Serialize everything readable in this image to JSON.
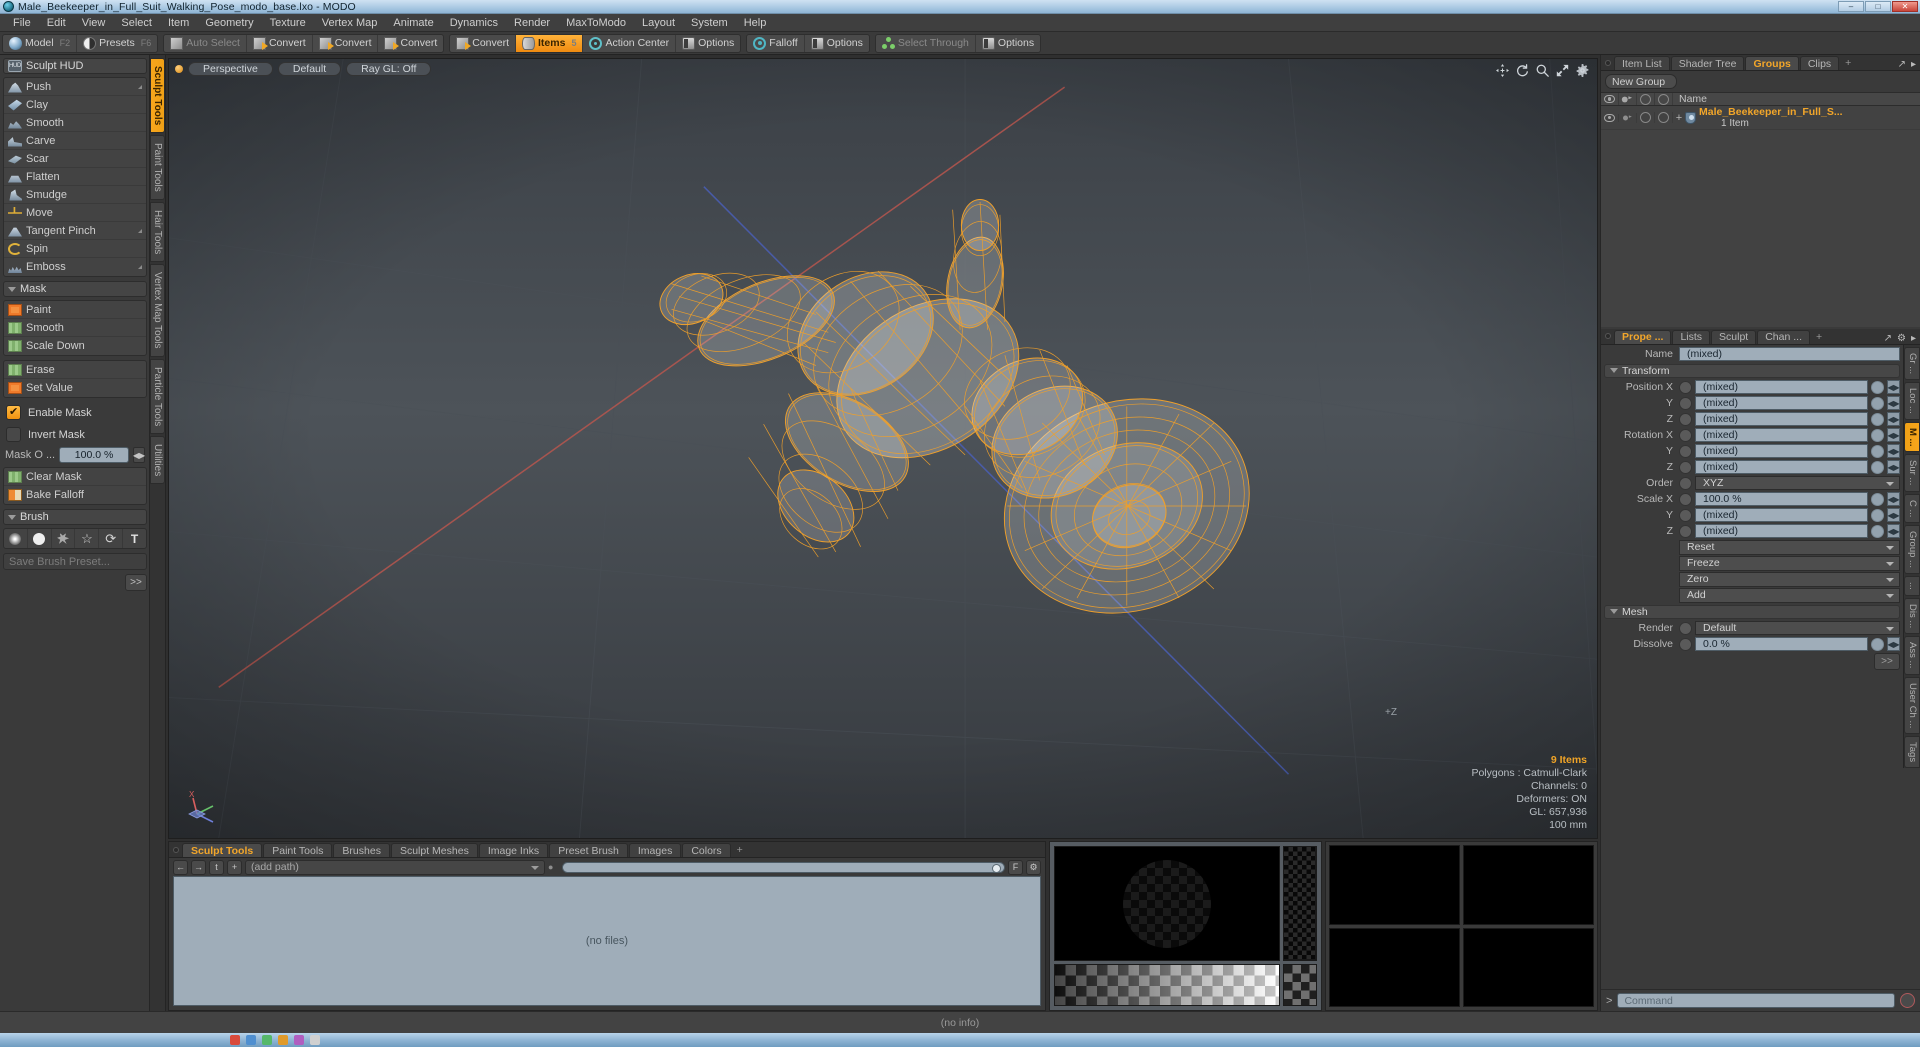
{
  "window": {
    "title": "Male_Beekeeper_in_Full_Suit_Walking_Pose_modo_base.lxo - MODO",
    "min_label": "–",
    "max_label": "□",
    "close_label": "✕"
  },
  "menubar": {
    "items": [
      "File",
      "Edit",
      "View",
      "Select",
      "Item",
      "Geometry",
      "Texture",
      "Vertex Map",
      "Animate",
      "Dynamics",
      "Render",
      "MaxToModo",
      "Layout",
      "System",
      "Help"
    ]
  },
  "toolbar": {
    "groups": [
      {
        "buttons": [
          {
            "label": "Model",
            "icon": "sphere-icon",
            "fkey": "F2",
            "state": "normal"
          },
          {
            "label": "Presets",
            "icon": "half-sphere-icon",
            "fkey": "F6",
            "state": "normal"
          }
        ]
      },
      {
        "buttons": [
          {
            "label": "Auto Select",
            "icon": "cube-icon",
            "fkey": "",
            "state": "dim"
          },
          {
            "label": "Convert",
            "icon": "cube-gold-icon",
            "fkey": "",
            "state": "normal"
          },
          {
            "label": "Convert",
            "icon": "cube-gold-icon",
            "fkey": "",
            "state": "normal"
          },
          {
            "label": "Convert",
            "icon": "cube-gold-icon",
            "fkey": "",
            "state": "normal"
          }
        ]
      },
      {
        "buttons": [
          {
            "label": "Convert",
            "icon": "cube-gold-icon",
            "fkey": "",
            "state": "normal"
          },
          {
            "label": "Items",
            "icon": "cylinder-icon",
            "fkey": "5",
            "state": "active"
          },
          {
            "label": "Action Center",
            "icon": "target-icon",
            "fkey": "",
            "state": "normal"
          },
          {
            "label": "Options",
            "icon": "panel-icon",
            "fkey": "",
            "state": "normal"
          }
        ]
      },
      {
        "buttons": [
          {
            "label": "Falloff",
            "icon": "ring-icon",
            "fkey": "",
            "state": "normal"
          },
          {
            "label": "Options",
            "icon": "panel-icon",
            "fkey": "",
            "state": "normal"
          }
        ]
      },
      {
        "buttons": [
          {
            "label": "Select Through",
            "icon": "nodes-icon",
            "fkey": "",
            "state": "dim"
          },
          {
            "label": "Options",
            "icon": "panel-icon",
            "fkey": "",
            "state": "normal"
          }
        ]
      }
    ]
  },
  "left_panel": {
    "hud_button": "Sculpt HUD",
    "sculpt_tools": [
      {
        "label": "Push",
        "icon": "push-icon",
        "corner": true
      },
      {
        "label": "Clay",
        "icon": "clay-icon",
        "corner": false
      },
      {
        "label": "Smooth",
        "icon": "smooth-icon",
        "corner": false
      },
      {
        "label": "Carve",
        "icon": "carve-icon",
        "corner": false
      },
      {
        "label": "Scar",
        "icon": "scar-icon",
        "corner": false
      },
      {
        "label": "Flatten",
        "icon": "flatten-icon",
        "corner": false
      },
      {
        "label": "Smudge",
        "icon": "smudge-icon",
        "corner": false
      },
      {
        "label": "Move",
        "icon": "move-icon",
        "corner": false
      },
      {
        "label": "Tangent Pinch",
        "icon": "pinch-icon",
        "corner": true
      },
      {
        "label": "Spin",
        "icon": "spin-icon",
        "corner": false
      },
      {
        "label": "Emboss",
        "icon": "emboss-icon",
        "corner": true
      }
    ],
    "mask_section_label": "Mask",
    "mask_tools": [
      {
        "label": "Paint",
        "icon": "mask-paint-icon"
      },
      {
        "label": "Smooth",
        "icon": "mask-smooth-icon"
      },
      {
        "label": "Scale Down",
        "icon": "mask-scale-icon"
      }
    ],
    "mask_tools2": [
      {
        "label": "Erase",
        "icon": "mask-erase-icon"
      },
      {
        "label": "Set Value",
        "icon": "mask-setvalue-icon"
      }
    ],
    "enable_mask": {
      "label": "Enable Mask",
      "checked": true
    },
    "invert_mask": {
      "label": "Invert Mask",
      "checked": false
    },
    "mask_opacity": {
      "label": "Mask O ...",
      "value": "100.0 %"
    },
    "mask_tools3": [
      {
        "label": "Clear Mask",
        "icon": "mask-clear-icon"
      },
      {
        "label": "Bake Falloff",
        "icon": "bake-falloff-icon"
      }
    ],
    "brush_section_label": "Brush",
    "brush_icons": [
      "soft-brush-icon",
      "hard-brush-icon",
      "splat-brush-icon",
      "star-brush-icon",
      "curve-brush-icon",
      "text-brush-icon"
    ],
    "brush_text_glyph": "T",
    "save_brush_preset": "Save Brush Preset...",
    "more_button": ">>"
  },
  "left_vtabs": [
    {
      "label": "Sculpt Tools",
      "active": true
    },
    {
      "label": "Paint Tools",
      "active": false
    },
    {
      "label": "Hair Tools",
      "active": false
    },
    {
      "label": "Vertex Map Tools",
      "active": false
    },
    {
      "label": "Particle Tools",
      "active": false
    },
    {
      "label": "Utilities",
      "active": false
    }
  ],
  "viewport": {
    "pills": [
      "Perspective",
      "Default",
      "Ray GL: Off"
    ],
    "tool_icons": [
      "pan-icon",
      "rotate-icon",
      "zoom-icon",
      "fit-icon",
      "gear-icon"
    ],
    "info": {
      "items": "9 Items",
      "polygons": "Polygons : Catmull-Clark",
      "channels": "Channels: 0",
      "deformers": "Deformers: ON",
      "gl": "GL: 657,936",
      "scale": "100 mm"
    },
    "axis_labels": [
      "X",
      "Y",
      "Z"
    ],
    "far_z_label": "+Z",
    "mesh_color": "#f0a02a"
  },
  "bottom_panel": {
    "tabs": [
      {
        "label": "Sculpt Tools",
        "active": true
      },
      {
        "label": "Paint Tools",
        "active": false
      },
      {
        "label": "Brushes",
        "active": false
      },
      {
        "label": "Sculpt Meshes",
        "active": false
      },
      {
        "label": "Image Inks",
        "active": false
      },
      {
        "label": "Preset Brush",
        "active": false
      },
      {
        "label": "Images",
        "active": false
      },
      {
        "label": "Colors",
        "active": false
      }
    ],
    "add_tab": "+",
    "nav_buttons": [
      "back-arrow-icon",
      "forward-arrow-icon",
      "up-folder-icon",
      "add-icon"
    ],
    "path_placeholder": "(add path)",
    "file_list_empty": "(no files)",
    "panel_icons": [
      "expand-icon",
      "gear-icon"
    ]
  },
  "right_panel": {
    "top_tabs": [
      {
        "label": "Item List",
        "active": false
      },
      {
        "label": "Shader Tree",
        "active": false
      },
      {
        "label": "Groups",
        "active": true
      },
      {
        "label": "Clips",
        "active": false
      }
    ],
    "add_tab": "+",
    "new_group_button": "New Group",
    "list_header": {
      "name": "Name"
    },
    "list_items": [
      {
        "name": "Male_Beekeeper_in_Full_S...",
        "sub": "1 Item",
        "expander": "+"
      }
    ],
    "prop_tabs": [
      {
        "label": "Prope ...",
        "active": true
      },
      {
        "label": "Lists",
        "active": false
      },
      {
        "label": "Sculpt",
        "active": false
      },
      {
        "label": "Chan ...",
        "active": false
      }
    ],
    "prop_add_tab": "+",
    "name_field": {
      "label": "Name",
      "value": "(mixed)"
    },
    "transform_section": "Transform",
    "transform_rows": [
      {
        "label": "Position X",
        "value": "(mixed)",
        "type": "value"
      },
      {
        "label": "Y",
        "value": "(mixed)",
        "type": "value"
      },
      {
        "label": "Z",
        "value": "(mixed)",
        "type": "value"
      },
      {
        "label": "Rotation X",
        "value": "(mixed)",
        "type": "value"
      },
      {
        "label": "Y",
        "value": "(mixed)",
        "type": "value"
      },
      {
        "label": "Z",
        "value": "(mixed)",
        "type": "value"
      },
      {
        "label": "Order",
        "value": "XYZ",
        "type": "dropdown"
      },
      {
        "label": "Scale X",
        "value": "100.0 %",
        "type": "value"
      },
      {
        "label": "Y",
        "value": "(mixed)",
        "type": "value"
      },
      {
        "label": "Z",
        "value": "(mixed)",
        "type": "value"
      }
    ],
    "action_dropdowns": [
      "Reset",
      "Freeze",
      "Zero",
      "Add"
    ],
    "mesh_section": "Mesh",
    "mesh_rows": [
      {
        "label": "Render",
        "value": "Default",
        "type": "dropdown"
      },
      {
        "label": "Dissolve",
        "value": "0.0 %",
        "type": "value"
      }
    ],
    "more_button": ">>",
    "side_tabs": [
      "Gr ...",
      "Loc ...",
      "M ...",
      "Sur ...",
      "C ...",
      "Group ...",
      "...",
      "Dis ...",
      "Ass ...",
      "User Ch ...",
      "Tags"
    ],
    "side_tab_active_index": 2
  },
  "command_bar": {
    "prompt": ">",
    "placeholder": "Command",
    "record_icon": "record-icon"
  },
  "status_bar": {
    "text": "(no info)"
  },
  "colors": {
    "accent_orange": "#f2a62a",
    "panel_bg": "#3a3a3a",
    "field_bg": "#9fadb9",
    "mesh_wire": "#f0a02a"
  }
}
